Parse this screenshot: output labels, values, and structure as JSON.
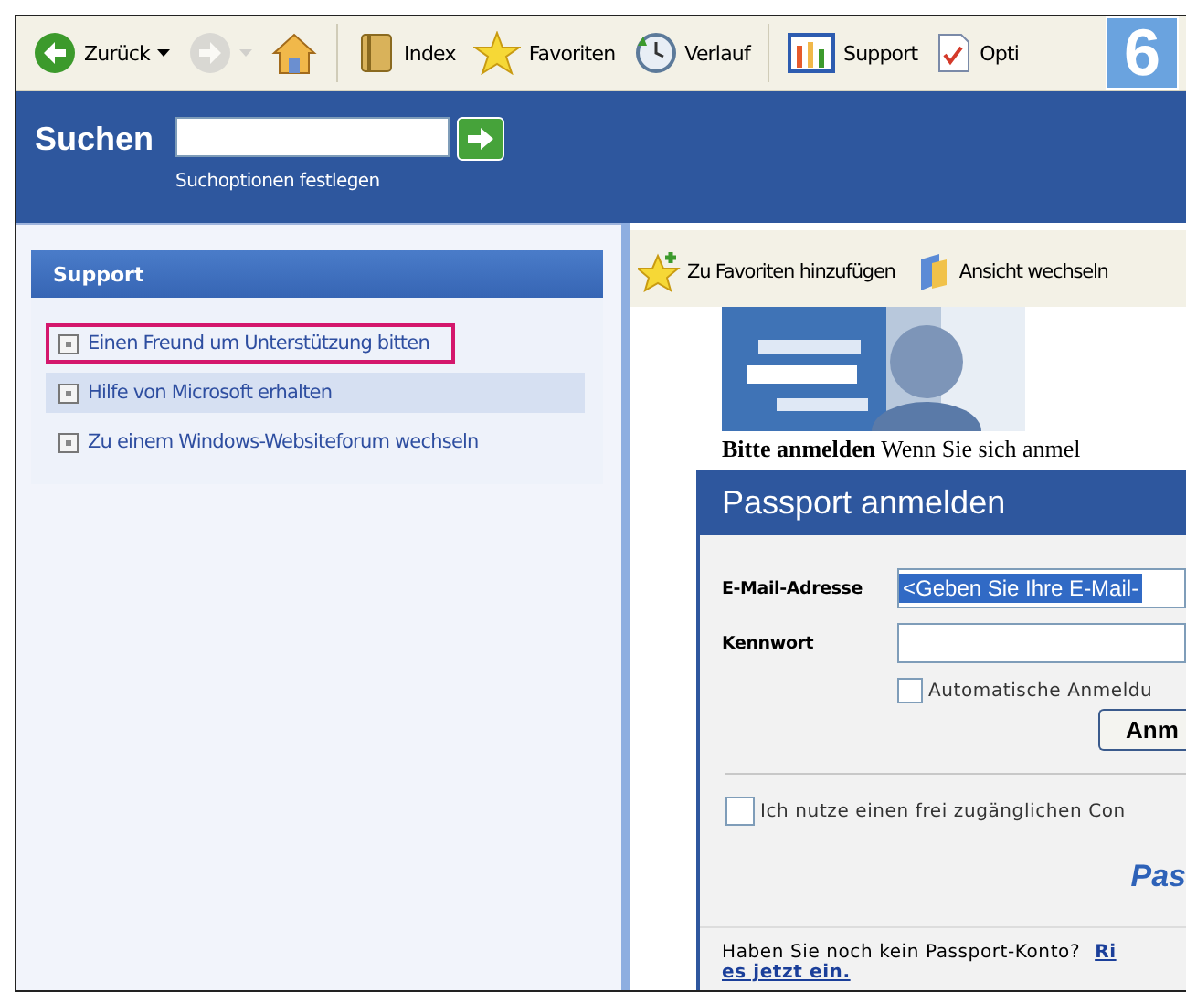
{
  "badge": "6",
  "toolbar": [
    {
      "kind": "back",
      "label": "Zurück",
      "dropdown": true,
      "disabled": false
    },
    {
      "kind": "forward",
      "dropdown": true,
      "disabled": true
    },
    {
      "kind": "home",
      "dropdown": false,
      "disabled": false
    },
    {
      "kind": "index",
      "label": "Index",
      "dropdown": false,
      "disabled": false
    },
    {
      "kind": "favorites",
      "label": "Favoriten",
      "dropdown": false,
      "disabled": false
    },
    {
      "kind": "history",
      "label": "Verlauf",
      "dropdown": false,
      "disabled": false
    },
    {
      "kind": "support",
      "label": "Support",
      "dropdown": false,
      "disabled": false
    },
    {
      "kind": "options",
      "label": "Opti",
      "dropdown": false,
      "disabled": false
    }
  ],
  "search": {
    "title": "Suchen",
    "options_link": "Suchoptionen festlegen"
  },
  "panel": {
    "title": "Support",
    "items": [
      {
        "label": "Einen Freund um Unterstützung bitten",
        "marked": true,
        "highlighted": false
      },
      {
        "label": "Hilfe von Microsoft erhalten",
        "marked": false,
        "highlighted": true
      },
      {
        "label": "Zu einem Windows-Websiteforum wechseln",
        "marked": false,
        "highlighted": false
      }
    ]
  },
  "content_toolbar": [
    {
      "kind": "add-favorite",
      "label": "Zu Favoriten hinzufügen"
    },
    {
      "kind": "switch-view",
      "label": "Ansicht wechseln"
    }
  ],
  "intro": "**Bitte anmelden** Wenn Sie sich anmel",
  "passport": {
    "title": "Passport anmelden",
    "email_label": "E-Mail-Adresse",
    "email_value": "<Geben Sie Ihre E-Mail-",
    "password_label": "Kennwort",
    "auto_login": {
      "label": "Automatische Anmeldu",
      "checked": false
    },
    "button": "Anm",
    "public_computer": {
      "label": "Ich nutze einen frei zugänglichen Con",
      "checked": false
    },
    "logo": "Pas",
    "footer": "Haben Sie noch kein Passport-Konto?",
    "footer_link": [
      "Ri",
      "es jetzt ein."
    ]
  }
}
